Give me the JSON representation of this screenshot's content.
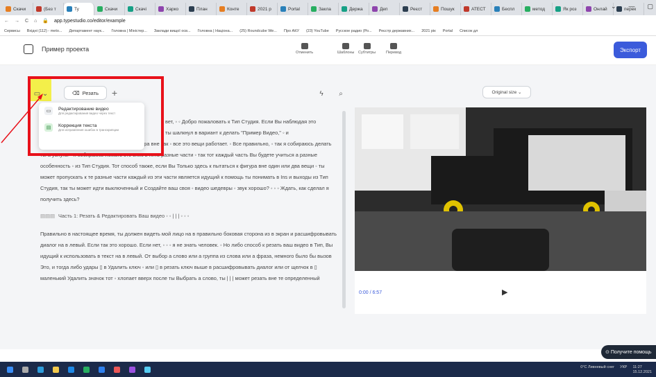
{
  "browser": {
    "tabs": [
      "Скачи",
      "(Без т",
      "Ту",
      "Скачи",
      "Скачі",
      "Харко",
      "План",
      "Конте",
      "2021 р",
      "Portal",
      "Закла",
      "Держа",
      "Деп",
      "Реєст",
      "Пошук",
      "АТЕСТ",
      "Беспл",
      "метод",
      "Як роз",
      "Онлай",
      "перек"
    ],
    "url": "app.typestudio.co/editor/example",
    "bookmarks": [
      "Сервисы",
      "Вхідні (112) - meto...",
      "Департамент наук...",
      "Головна | Міністер...",
      "Заклади вищої осв...",
      "Головна | Націона...",
      "(25) Roundcube We...",
      "Про АКУ",
      "(23) YouTube",
      "Русское радио (Ро...",
      "Реєстр державних...",
      "2021 рік",
      "Portal",
      "Список дл"
    ]
  },
  "header": {
    "project_name": "Пример проекта",
    "buttons": [
      "Отменить",
      "Шаблоны",
      "Субтитры",
      "Перевод"
    ],
    "export_label": "Экспорт"
  },
  "toolbar": {
    "cut_label": "Резать",
    "size_label": "Original size"
  },
  "dropdown": {
    "items": [
      {
        "title": "Редактирование видео",
        "subtitle": "Для редактирования видео через текст"
      },
      {
        "title": "Коррекция текста",
        "subtitle": "Для исправления ошибок в транскрипции"
      }
    ]
  },
  "editor": {
    "p1_start": "вет, ◦ ◦ Добро пожаловать к Тип Студия. Если Вы наблюдая это",
    "p1_line2": "ты шалкнул в вариант к делать \"Пример Видео,\" ◦ и",
    "p1_rest": "в настоящее время Вы пытающийся к фигура вне как ◦ все это вещи работает. ◦ Все правильно, ◦ так я собираюсь делать ты а услуга. ◦ я собираюсь ломать это вниз в пять разные части ◦ так тот каждый часть Вы будете учиться а разные особенность ◦ из Тип Студия. Тот способ также, если Вы Только здесь к пытаться к фигура вне один или два вещи ◦ ты может пропускать к те разные части каждый из эти части является идущий к помощь ты понимать в Ins и выходы из Тип Студия, так ты может идти выключенный и Создайте ваш своя ◦ видео шедевры ◦ звук хорошо? ◦ ◦ ◦ Ждать, как сделал я получить здесь?",
    "chapter": "Часть 1: Резать & Редактировать Ваш видео ◦ ◦ | | | ◦ ◦ ◦",
    "p2": "Правильно в настоящее время, ты должен видеть мой лицо на в правильно боковая сторона из в экран и расшифровывать диалог на в левый. Если так это хорошо. Если нет, ◦ ◦ ◦ я не знать человек. ◦ Но либо способ к резать ваш видео в Тип, Вы идущий к использовать в текст на в левый. От выбор а слово или а группа из слова или а фраза, немного было бы вызов Это, и тогда либо удары ▯ в Удалить ключ ◦ или ▯ в резать ключ выше в расшифровывать диалог или от щелчок в ▯ маленький Удалить значок тот ◦ хлопает вверх после ты Выбрать а слово, ты | | | может резать вне те определенный"
  },
  "player": {
    "time": "0:00 / 6:57"
  },
  "help_label": "Получите помощь",
  "taskbar": {
    "weather": "0°C Ливневый снег",
    "lang": "УКР",
    "time": "11:27",
    "date": "15.12.2021"
  }
}
